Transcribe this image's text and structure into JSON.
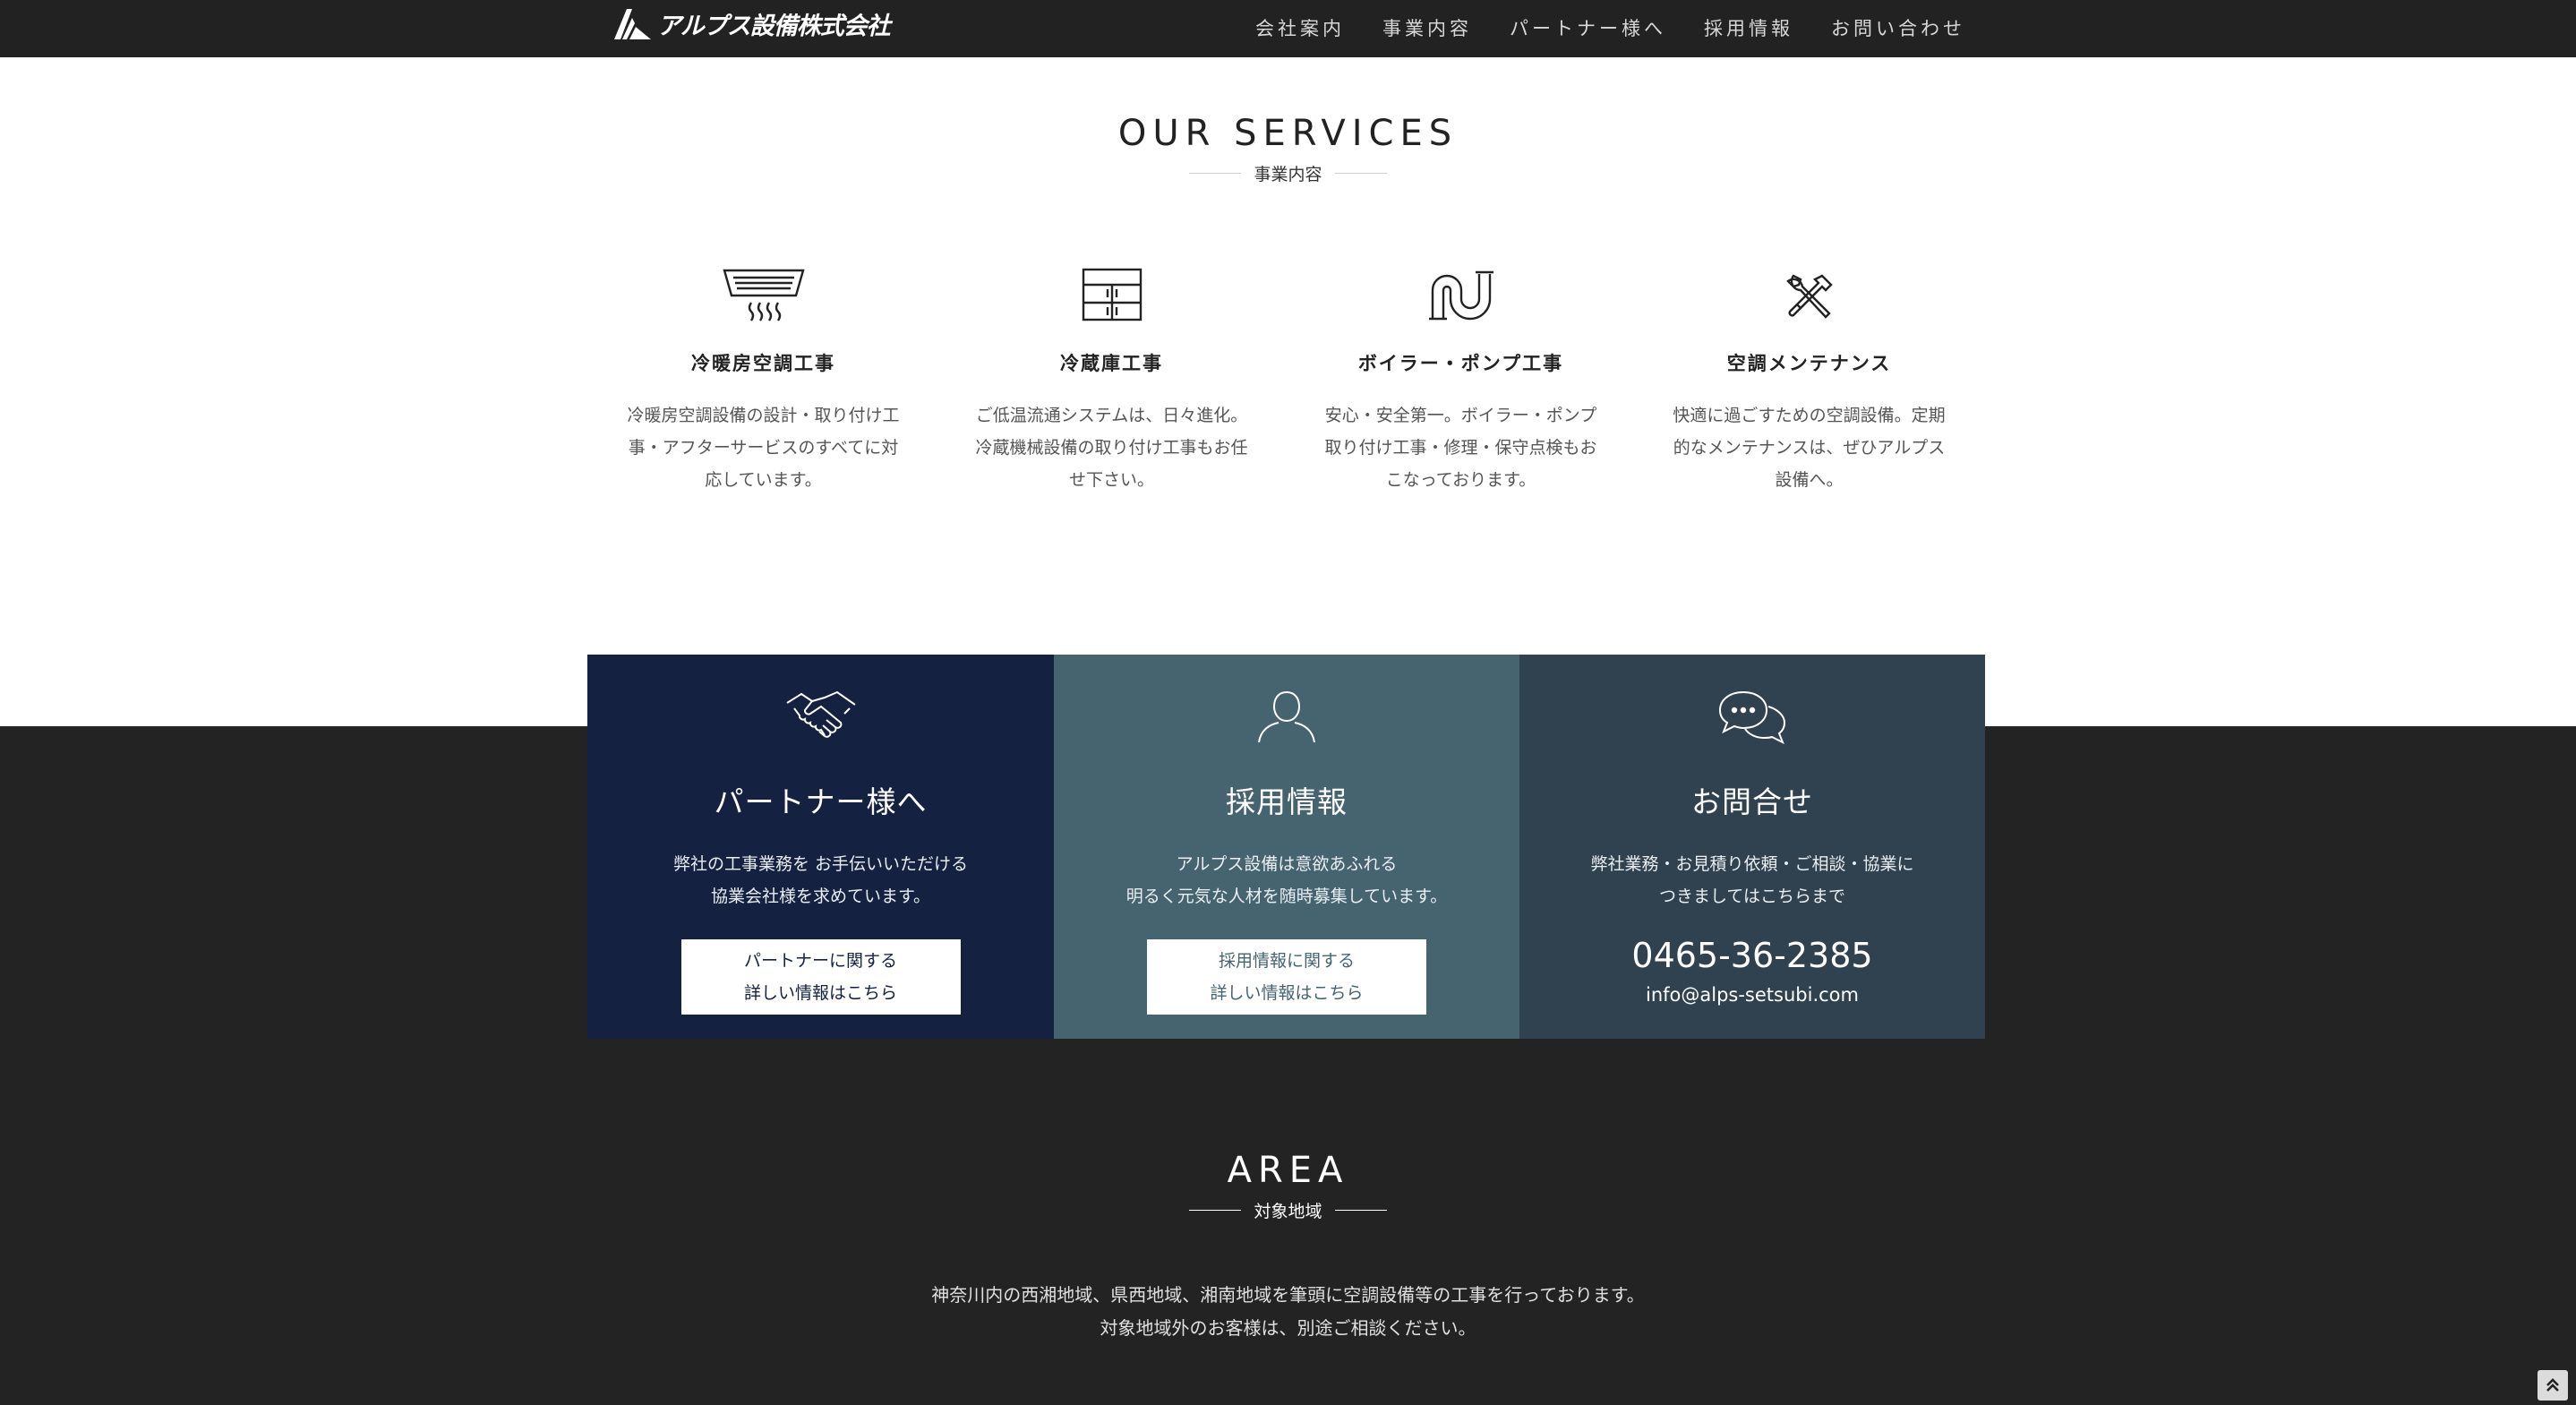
{
  "header": {
    "logo_text": "アルプス設備株式会社",
    "nav": [
      "会社案内",
      "事業内容",
      "パートナー様へ",
      "採用情報",
      "お問い合わせ"
    ]
  },
  "services": {
    "heading_en": "OUR SERVICES",
    "heading_jp": "事業内容",
    "items": [
      {
        "icon": "air-conditioner-icon",
        "title": "冷暖房空調工事",
        "desc": "冷暖房空調設備の設計・取り付け工事・アフターサービスのすべてに対応しています。"
      },
      {
        "icon": "refrigerator-icon",
        "title": "冷蔵庫工事",
        "desc": "ご低温流通システムは、日々進化。冷蔵機械設備の取り付け工事もお任せ下さい。"
      },
      {
        "icon": "pipe-icon",
        "title": "ボイラー・ポンプ工事",
        "desc": "安心・安全第一。ボイラー・ポンプ取り付け工事・修理・保守点検もおこなっております。"
      },
      {
        "icon": "tools-icon",
        "title": "空調メンテナンス",
        "desc": "快適に過ごすための空調設備。定期的なメンテナンスは、ぜひアルプス設備へ。"
      }
    ]
  },
  "panels": {
    "partner": {
      "icon": "handshake-icon",
      "title": "パートナー様へ",
      "desc_line1": "弊社の工事業務を お手伝いいただける",
      "desc_line2": "協業会社様を求めています。",
      "button_line1": "パートナーに関する",
      "button_line2": "詳しい情報はこちら",
      "bg": "#152141"
    },
    "recruit": {
      "icon": "person-icon",
      "title": "採用情報",
      "desc_line1": "アルプス設備は意欲あふれる",
      "desc_line2": "明るく元気な人材を随時募集しています。",
      "button_line1": "採用情報に関する",
      "button_line2": "詳しい情報はこちら",
      "bg": "#466470"
    },
    "contact": {
      "icon": "chat-bubbles-icon",
      "title": "お問合せ",
      "desc_line1": "弊社業務・お見積り依頼・ご相談・協業に",
      "desc_line2": "つきましてはこちらまで",
      "phone": "0465-36-2385",
      "email": "info@alps-setsubi.com",
      "bg": "#30424f"
    }
  },
  "area": {
    "heading_en": "AREA",
    "heading_jp": "対象地域",
    "line1": "神奈川内の西湘地域、県西地域、湘南地域を筆頭に空調設備等の工事を行っております。",
    "line2": "対象地域外のお客様は、別途ご相談ください。"
  },
  "colors": {
    "header_bg": "#222222",
    "dark_bg": "#232323"
  },
  "to_top_icon": "double-chevron-up-icon"
}
